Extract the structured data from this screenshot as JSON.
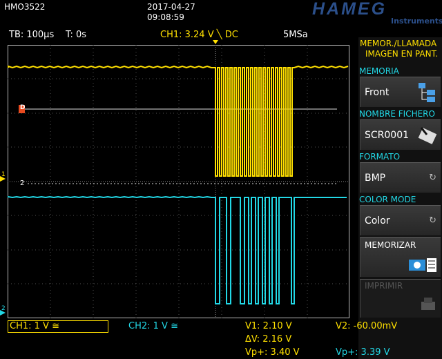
{
  "header": {
    "model": "HMO3522",
    "date": "2017-04-27",
    "time": "09:08:59",
    "brand": "HAMEG",
    "brand_sub": "Instruments"
  },
  "info_bar": {
    "timebase": "TB: 100µs",
    "trigger_time": "T: 0s",
    "trigger_info": "CH1: 3.24 V ╲ DC",
    "sample_rate": "5MSa"
  },
  "menu": {
    "title_line1": "MEMOR./LLAMADA",
    "title_line2": "IMAGEN EN PANT.",
    "items": [
      {
        "header": "MEMORIA",
        "value": "Front",
        "icon": "folder-tree-icon"
      },
      {
        "header": "NOMBRE FICHERO",
        "value": "SCR0001",
        "icon": "edit-keyboard-icon"
      },
      {
        "header": "FORMATO",
        "value": "BMP",
        "icon": "rotate-knob-icon"
      },
      {
        "header": "COLOR MODE",
        "value": "Color",
        "icon": "rotate-knob-icon"
      },
      {
        "header": "",
        "value": "MEMORIZAR",
        "icon": "camera-save-icon"
      },
      {
        "header": "",
        "value": "IMPRIMIR",
        "icon": "printer-icon"
      }
    ]
  },
  "markers": {
    "ch1_marker": "1",
    "ch2_marker": "2",
    "ch2_ground": "2",
    "ref_marker": "D"
  },
  "status": {
    "ch1": "CH1: 1 V ≅",
    "ch2": "CH2: 1 V ≅",
    "v1": "V1: 2.10 V",
    "v2": "V2: -60.00mV",
    "dv": "ΔV: 2.16 V",
    "vp1": "Vp+: 3.40 V",
    "vp2": "Vp+: 3.39 V"
  },
  "colors": {
    "ch1": "#ffe000",
    "ch2": "#22d8e6",
    "brand": "#2b4f8a",
    "menu_header": "#22d8e6"
  }
}
